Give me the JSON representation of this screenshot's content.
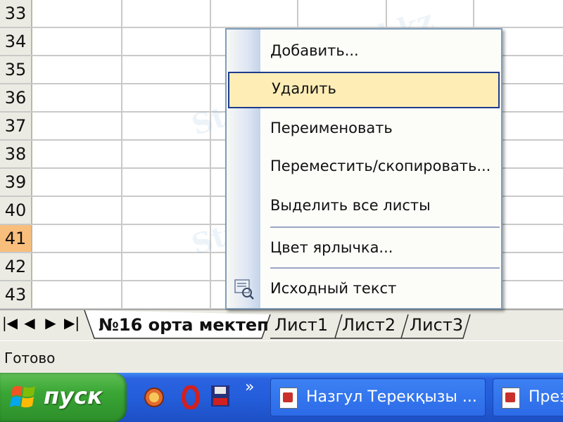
{
  "grid": {
    "rows": [
      {
        "num": "33",
        "selected": false
      },
      {
        "num": "34",
        "selected": false
      },
      {
        "num": "35",
        "selected": false
      },
      {
        "num": "36",
        "selected": false
      },
      {
        "num": "37",
        "selected": false
      },
      {
        "num": "38",
        "selected": false
      },
      {
        "num": "39",
        "selected": false
      },
      {
        "num": "40",
        "selected": false
      },
      {
        "num": "41",
        "selected": true
      },
      {
        "num": "42",
        "selected": false
      },
      {
        "num": "43",
        "selected": false
      }
    ]
  },
  "context_menu": {
    "items": [
      {
        "label": "Добавить...",
        "highlighted": false
      },
      {
        "label": "Удалить",
        "highlighted": true
      },
      {
        "label": "Переименовать",
        "highlighted": false
      },
      {
        "label": "Переместить/скопировать...",
        "highlighted": false
      },
      {
        "label": "Выделить все листы",
        "highlighted": false
      },
      {
        "label": "Цвет ярлычка...",
        "highlighted": false
      },
      {
        "label": "Исходный текст",
        "highlighted": false
      }
    ]
  },
  "sheet_tabs": {
    "nav": [
      "|◀",
      "◀",
      "▶",
      "▶|"
    ],
    "tabs": [
      {
        "label": "№16 орта мектеп",
        "active": true
      },
      {
        "label": "Лист1",
        "active": false
      },
      {
        "label": "Лист2",
        "active": false
      },
      {
        "label": "Лист3",
        "active": false
      }
    ]
  },
  "status_bar": {
    "text": "Готово"
  },
  "taskbar": {
    "start_label": "пуск",
    "chevron": "»",
    "buttons": [
      {
        "label": "Назгул Терекқызы ..."
      },
      {
        "label": "През"
      }
    ]
  },
  "watermark": {
    "text": "Stud.kz"
  },
  "colors": {
    "selected_row_header": "#f8be7c",
    "menu_highlight": "#ffedb6",
    "taskbar_blue": "#245edb",
    "start_green": "#3aa635"
  }
}
